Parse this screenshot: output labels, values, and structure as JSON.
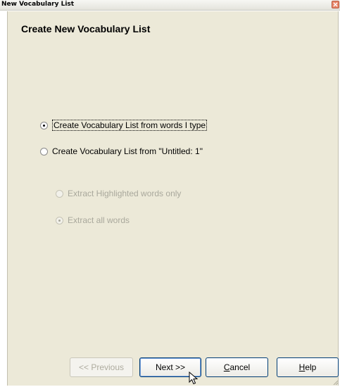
{
  "window": {
    "title": "New Vocabulary List"
  },
  "page": {
    "heading": "Create New Vocabulary List"
  },
  "options": {
    "from_typed": {
      "label": "Create Vocabulary List from words I type",
      "checked": true
    },
    "from_document": {
      "label": "Create Vocabulary List from \"Untitled: 1\"",
      "checked": false
    },
    "highlighted_only": {
      "label": "Extract Highlighted words only",
      "checked": false,
      "disabled": true
    },
    "all_words": {
      "label": "Extract all words",
      "checked": true,
      "disabled": true
    }
  },
  "buttons": {
    "previous": "<< Previous",
    "next": "Next >>",
    "cancel_prefix": "C",
    "cancel_rest": "ancel",
    "help_prefix": "H",
    "help_rest": "elp"
  },
  "colors": {
    "dialog_bg": "#ece9d8",
    "button_border": "#003c74",
    "disabled_text": "#a9a89c"
  }
}
